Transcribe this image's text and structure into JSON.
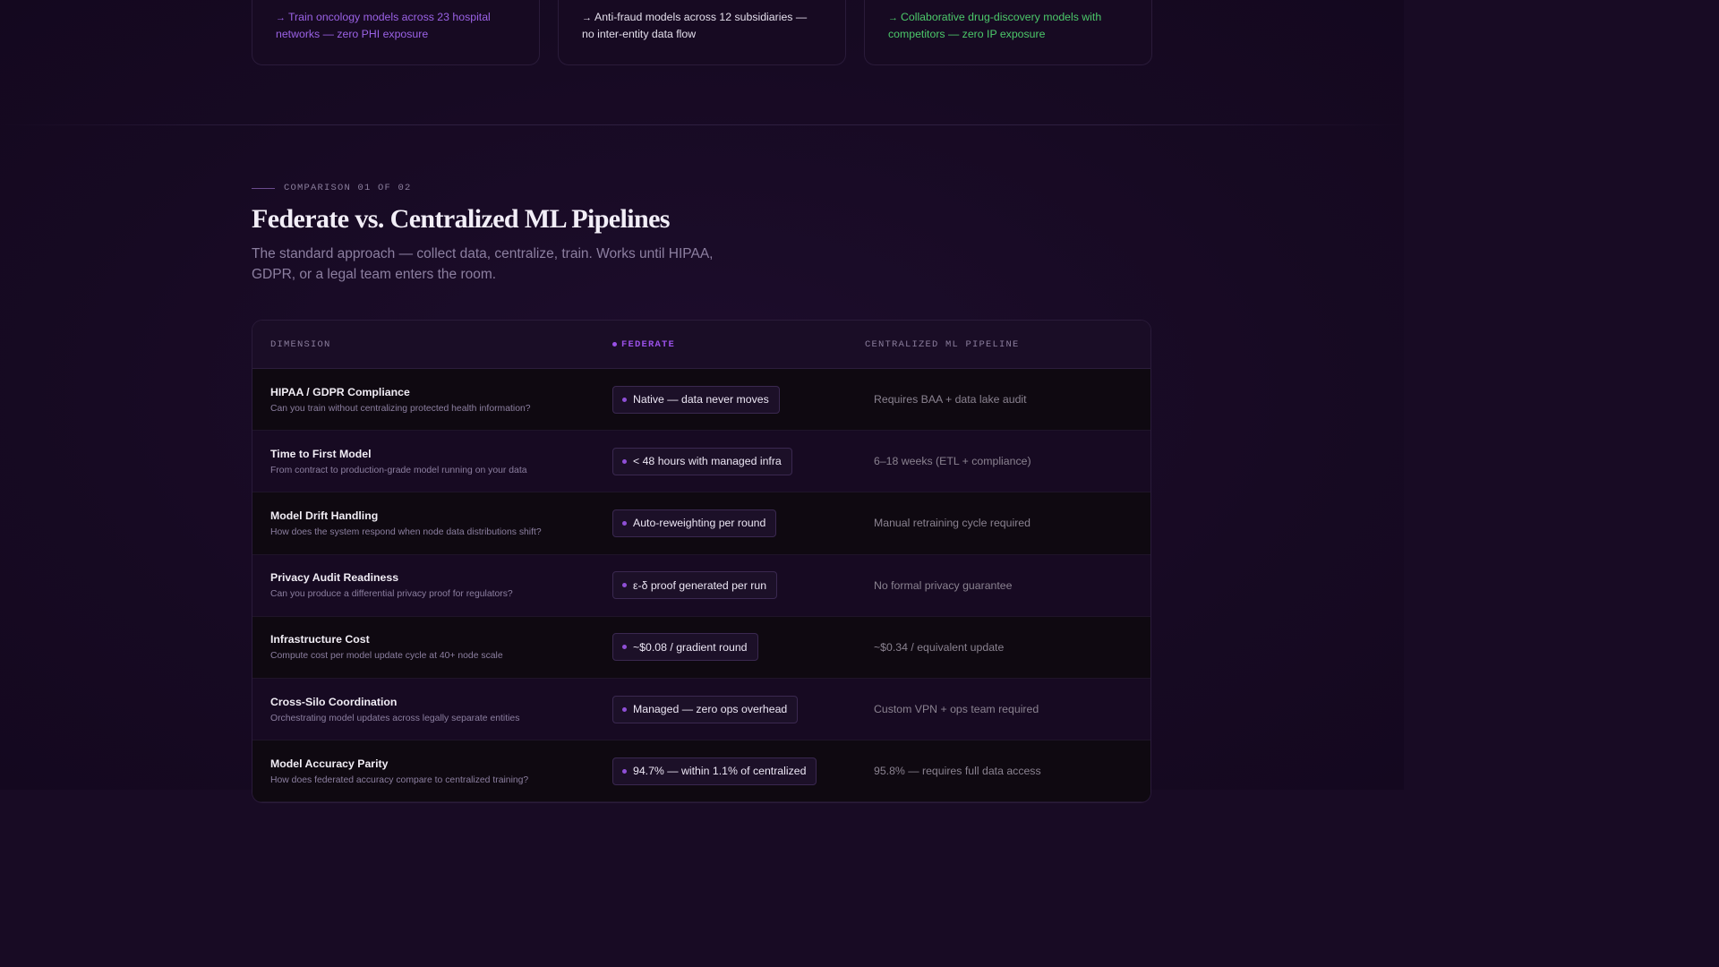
{
  "cards": [
    {
      "arrow": "→",
      "text": "Train oncology models across 23 hospital networks — zero PHI exposure"
    },
    {
      "arrow": "→",
      "text": "Anti-fraud models across 12 subsidiaries — no inter-entity data flow"
    },
    {
      "arrow": "→",
      "text": "Collaborative drug-discovery models with competitors — zero IP exposure"
    }
  ],
  "section": {
    "eyebrow": "COMPARISON 01 OF 02",
    "title": "Federate vs. Centralized ML Pipelines",
    "subtitle": "The standard approach — collect data, centralize, train. Works until HIPAA, GDPR, or a legal team enters the room."
  },
  "table": {
    "headers": {
      "dimension": "DIMENSION",
      "federate": "FEDERATE",
      "centralized": "CENTRALIZED ML PIPELINE"
    },
    "rows": [
      {
        "title": "HIPAA / GDPR Compliance",
        "desc": "Can you train without centralizing protected health information?",
        "federate": "Native — data never moves",
        "centralized": "Requires BAA + data lake audit"
      },
      {
        "title": "Time to First Model",
        "desc": "From contract to production-grade model running on your data",
        "federate": "< 48 hours with managed infra",
        "centralized": "6–18 weeks (ETL + compliance)"
      },
      {
        "title": "Model Drift Handling",
        "desc": "How does the system respond when node data distributions shift?",
        "federate": "Auto-reweighting per round",
        "centralized": "Manual retraining cycle required"
      },
      {
        "title": "Privacy Audit Readiness",
        "desc": "Can you produce a differential privacy proof for regulators?",
        "federate": "ε-δ proof generated per run",
        "centralized": "No formal privacy guarantee"
      },
      {
        "title": "Infrastructure Cost",
        "desc": "Compute cost per model update cycle at 40+ node scale",
        "federate": "~$0.08 / gradient round",
        "centralized": "~$0.34 / equivalent update"
      },
      {
        "title": "Cross-Silo Coordination",
        "desc": "Orchestrating model updates across legally separate entities",
        "federate": "Managed — zero ops overhead",
        "centralized": "Custom VPN + ops team required"
      },
      {
        "title": "Model Accuracy Parity",
        "desc": "How does federated accuracy compare to centralized training?",
        "federate": "94.7% — within 1.1% of centralized",
        "centralized": "95.8% — requires full data access"
      }
    ]
  },
  "colors": {
    "accent_purple": "#9950e6",
    "accent_green": "#4cc96a",
    "background": "#180b24"
  }
}
